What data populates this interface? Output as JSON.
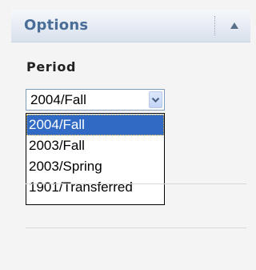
{
  "panel": {
    "title": "Options",
    "collapse_icon": "triangle-up-icon"
  },
  "period": {
    "label": "Period",
    "selected_value": "2004/Fall",
    "arrow_icon": "chevron-down-icon",
    "options": [
      {
        "label": "2004/Fall",
        "highlighted": true
      },
      {
        "label": "2003/Fall",
        "highlighted": false
      },
      {
        "label": "2003/Spring",
        "highlighted": false
      },
      {
        "label": "1901/Transferred",
        "highlighted": false
      }
    ]
  },
  "colors": {
    "title": "#4a6e98",
    "highlight": "#316ac5",
    "background": "#f4f4f4"
  }
}
